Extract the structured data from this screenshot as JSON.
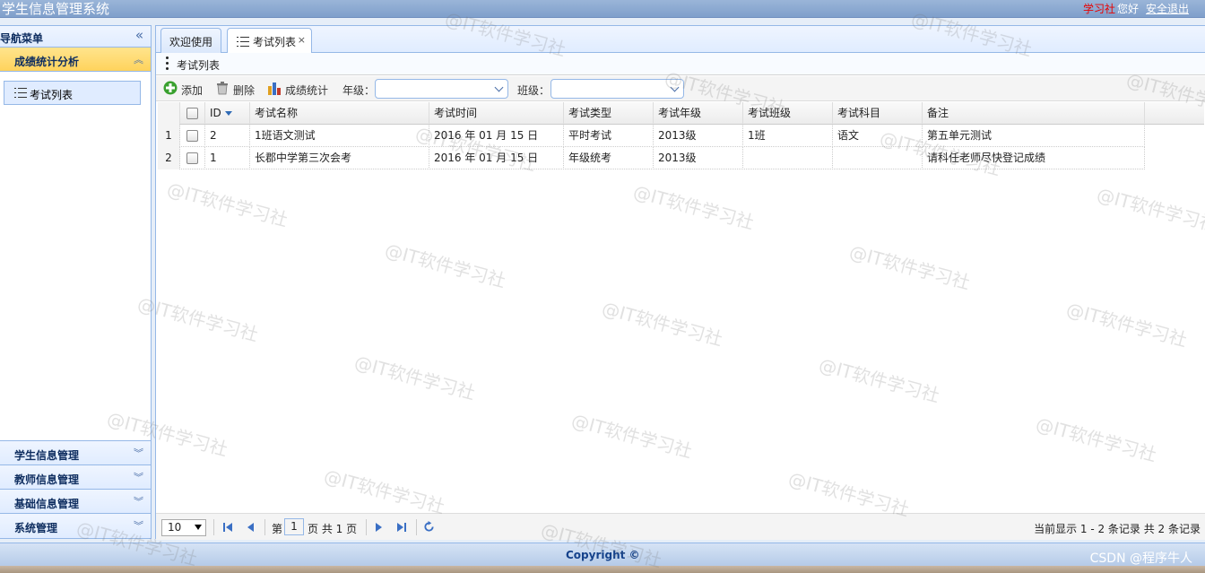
{
  "app": {
    "title": "学生信息管理系统",
    "user_name": "学习社",
    "greeting": "您好",
    "logout_label": "安全退出"
  },
  "sidebar": {
    "title": "导航菜单",
    "collapse_icon": "double-chevron-left-icon",
    "active_panel": {
      "label": "成绩统计分析",
      "items": [
        {
          "label": "考试列表",
          "icon": "list-icon"
        }
      ]
    },
    "panels": [
      {
        "label": "学生信息管理"
      },
      {
        "label": "教师信息管理"
      },
      {
        "label": "基础信息管理"
      },
      {
        "label": "系统管理"
      }
    ]
  },
  "tabs": [
    {
      "label": "欢迎使用"
    },
    {
      "label": "考试列表",
      "icon": "list-icon",
      "active": true
    }
  ],
  "panel_title": "考试列表",
  "toolbar": {
    "add_label": "添加",
    "delete_label": "删除",
    "stats_label": "成绩统计",
    "grade_label": "年级：",
    "class_label": "班级：",
    "grade_value": "",
    "class_value": ""
  },
  "table": {
    "headers": [
      "ID",
      "考试名称",
      "考试时间",
      "考试类型",
      "考试年级",
      "考试班级",
      "考试科目",
      "备注"
    ],
    "rows": [
      {
        "num": "1",
        "id": "2",
        "name": "1班语文测试",
        "time": "2016 年 01 月 15 日",
        "type": "平时考试",
        "grade": "2013级",
        "class": "1班",
        "subject": "语文",
        "note": "第五单元测试"
      },
      {
        "num": "2",
        "id": "1",
        "name": "长郡中学第三次会考",
        "time": "2016 年 01 月 15 日",
        "type": "年级统考",
        "grade": "2013级",
        "class": "",
        "subject": "",
        "note": "请科任老师尽快登记成绩"
      }
    ]
  },
  "pager": {
    "page_size": "10",
    "page_prefix": "第",
    "current_page": "1",
    "page_suffix": "页 共 1 页",
    "info": "当前显示 1 - 2 条记录 共 2 条记录"
  },
  "footer": {
    "copyright": "Copyright ©",
    "credit": "CSDN @程序牛人"
  },
  "watermark": "@IT软件学习社",
  "colors": {
    "header": "#7f9fcb",
    "border": "#95b8e7",
    "active_panel": "#ffd35c",
    "user_name": "#e80000"
  }
}
